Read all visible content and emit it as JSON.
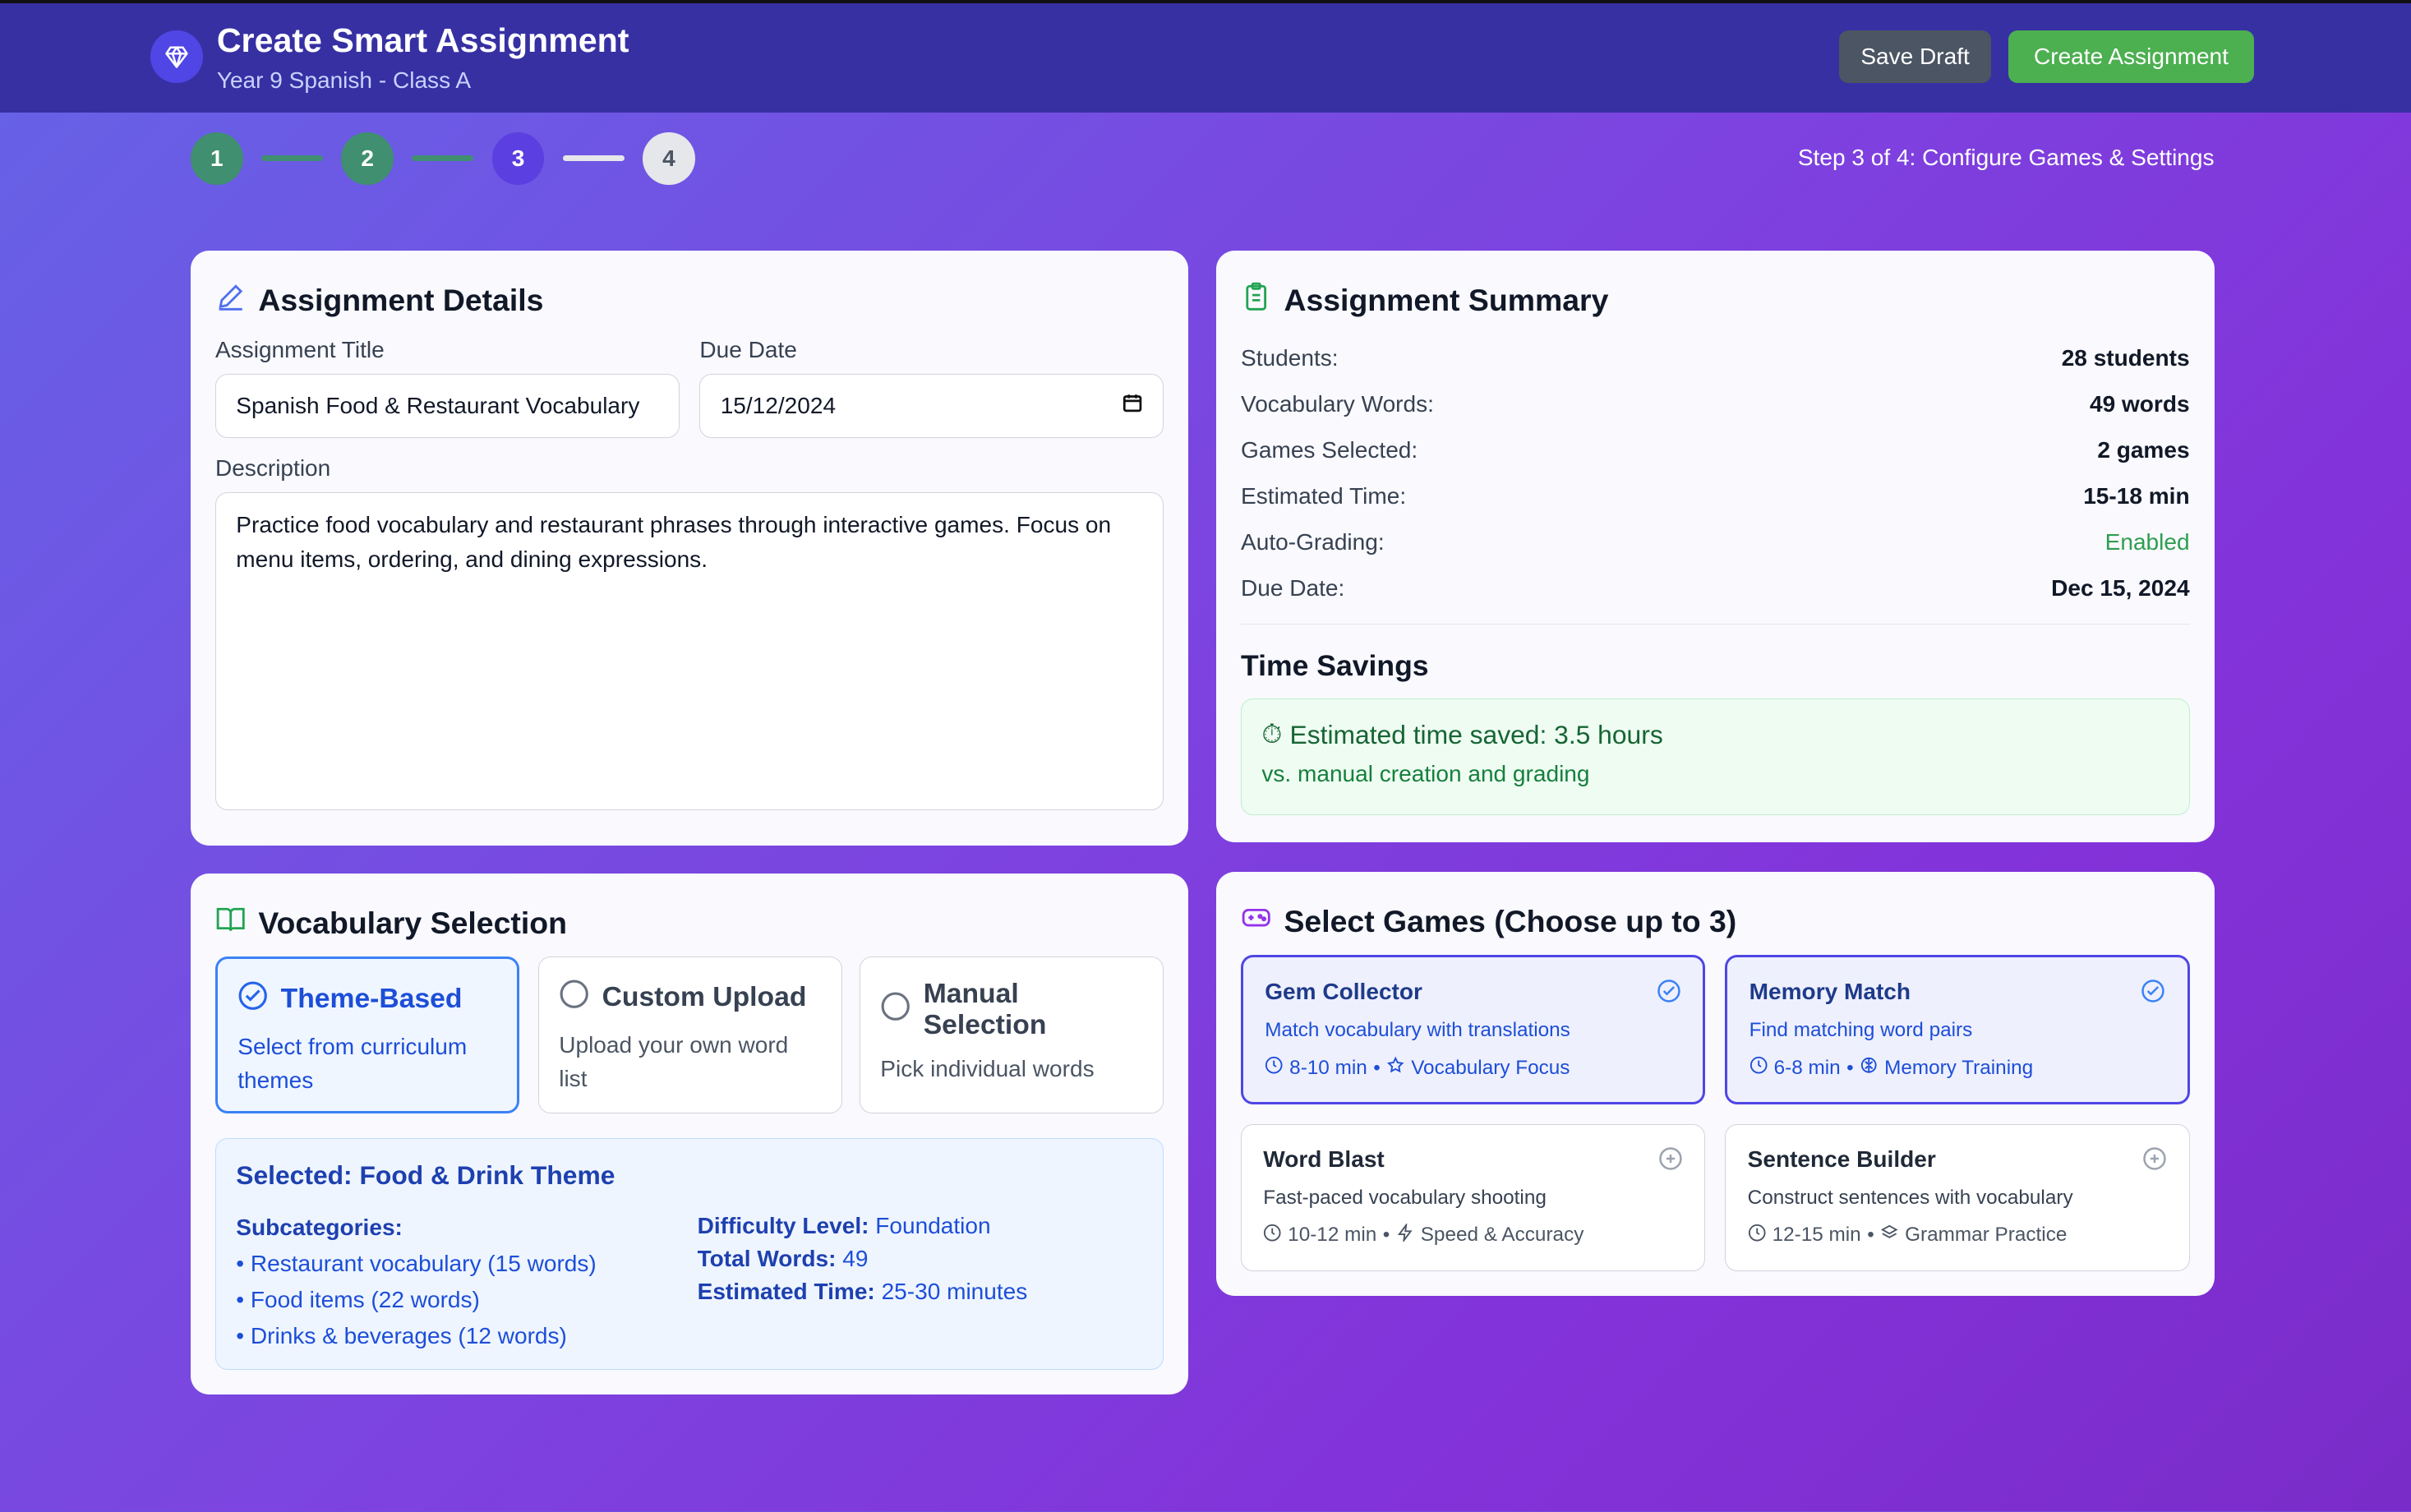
{
  "header": {
    "title": "Create Smart Assignment",
    "subtitle": "Year 9 Spanish - Class A",
    "save_draft": "Save Draft",
    "create_assignment": "Create Assignment"
  },
  "stepper": {
    "steps": [
      "1",
      "2",
      "3",
      "4"
    ],
    "current": 3,
    "total": 4,
    "status": "Step 3 of 4: Configure Games & Settings"
  },
  "details": {
    "heading": "Assignment Details",
    "title_label": "Assignment Title",
    "title_value": "Spanish Food & Restaurant Vocabulary",
    "due_label": "Due Date",
    "due_value": "15/12/2024",
    "desc_label": "Description",
    "desc_value": "Practice food vocabulary and restaurant phrases through interactive games. Focus on menu items, ordering, and dining expressions."
  },
  "summary": {
    "heading": "Assignment Summary",
    "rows": [
      {
        "label": "Students:",
        "value": "28 students"
      },
      {
        "label": "Vocabulary Words:",
        "value": "49 words"
      },
      {
        "label": "Games Selected:",
        "value": "2 games"
      },
      {
        "label": "Estimated Time:",
        "value": "15-18 min"
      },
      {
        "label": "Auto-Grading:",
        "value": "Enabled"
      },
      {
        "label": "Due Date:",
        "value": "Dec 15, 2024"
      }
    ],
    "time_heading": "Time Savings",
    "saved": "Estimated time saved: 3.5 hours",
    "saved_sub": "vs. manual creation and grading",
    "enabled_color": "#16a34a"
  },
  "vocab": {
    "heading": "Vocabulary Selection",
    "options": [
      {
        "title": "Theme-Based",
        "desc": "Select from curriculum themes"
      },
      {
        "title": "Custom Upload",
        "desc": "Upload your own word list"
      },
      {
        "title": "Manual Selection",
        "desc": "Pick individual words"
      }
    ],
    "selected_title": "Selected: Food & Drink Theme",
    "sub_label": "Subcategories:",
    "subcategories": [
      "• Restaurant vocabulary (15 words)",
      "• Food items (22 words)",
      "• Drinks & beverages (12 words)"
    ],
    "difficulty_label": "Difficulty Level:",
    "difficulty": "Foundation",
    "total_label": "Total Words:",
    "total": "49",
    "time_label": "Estimated Time:",
    "time": "25-30 minutes"
  },
  "games": {
    "heading": "Select Games (Choose up to 3)",
    "items": [
      {
        "name": "Gem Collector",
        "desc": "Match vocabulary with translations",
        "time": "8-10 min",
        "tag": "Vocabulary Focus",
        "selected": true
      },
      {
        "name": "Memory Match",
        "desc": "Find matching word pairs",
        "time": "6-8 min",
        "tag": "Memory Training",
        "selected": true
      },
      {
        "name": "Word Blast",
        "desc": "Fast-paced vocabulary shooting",
        "time": "10-12 min",
        "tag": "Speed & Accuracy",
        "selected": false
      },
      {
        "name": "Sentence Builder",
        "desc": "Construct sentences with vocabulary",
        "time": "12-15 min",
        "tag": "Grammar Practice",
        "selected": false
      }
    ],
    "bullet": "•"
  }
}
